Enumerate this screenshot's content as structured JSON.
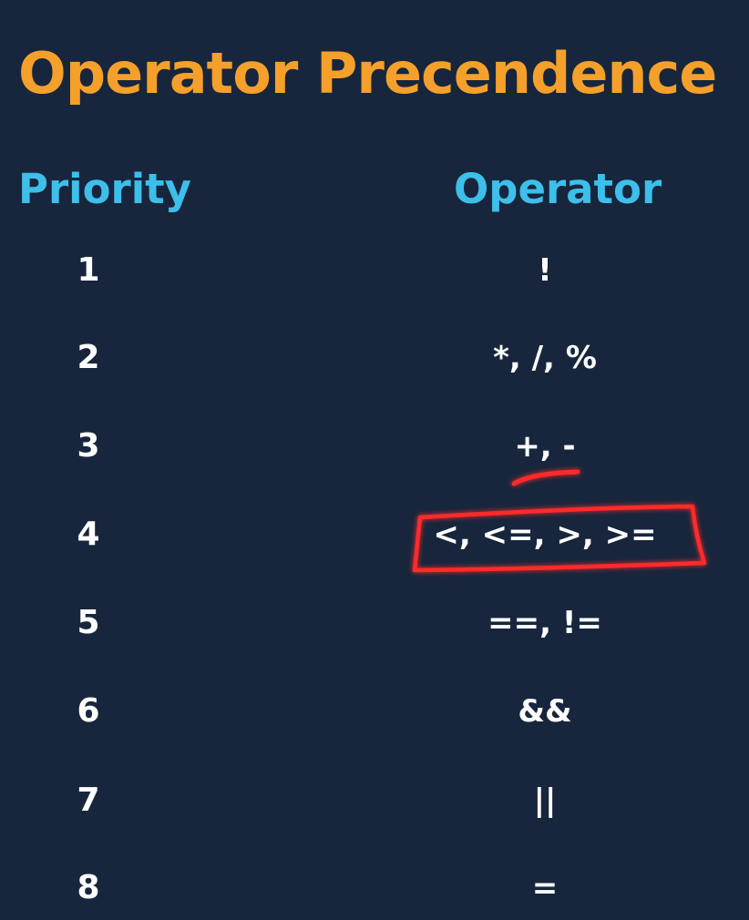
{
  "title": "Operator Precendence",
  "headers": {
    "priority": "Priority",
    "operator": "Operator"
  },
  "rows": [
    {
      "priority": "1",
      "operator": "!"
    },
    {
      "priority": "2",
      "operator": "*, /, %"
    },
    {
      "priority": "3",
      "operator": "+, -"
    },
    {
      "priority": "4",
      "operator": "<, <=, >, >="
    },
    {
      "priority": "5",
      "operator": "==, !="
    },
    {
      "priority": "6",
      "operator": "&&"
    },
    {
      "priority": "7",
      "operator": "||"
    },
    {
      "priority": "8",
      "operator": "="
    }
  ],
  "colors": {
    "background": "#17263c",
    "title": "#f5a02a",
    "header": "#3dbfea",
    "text": "#ffffff",
    "annotation": "#ff2a2a"
  }
}
